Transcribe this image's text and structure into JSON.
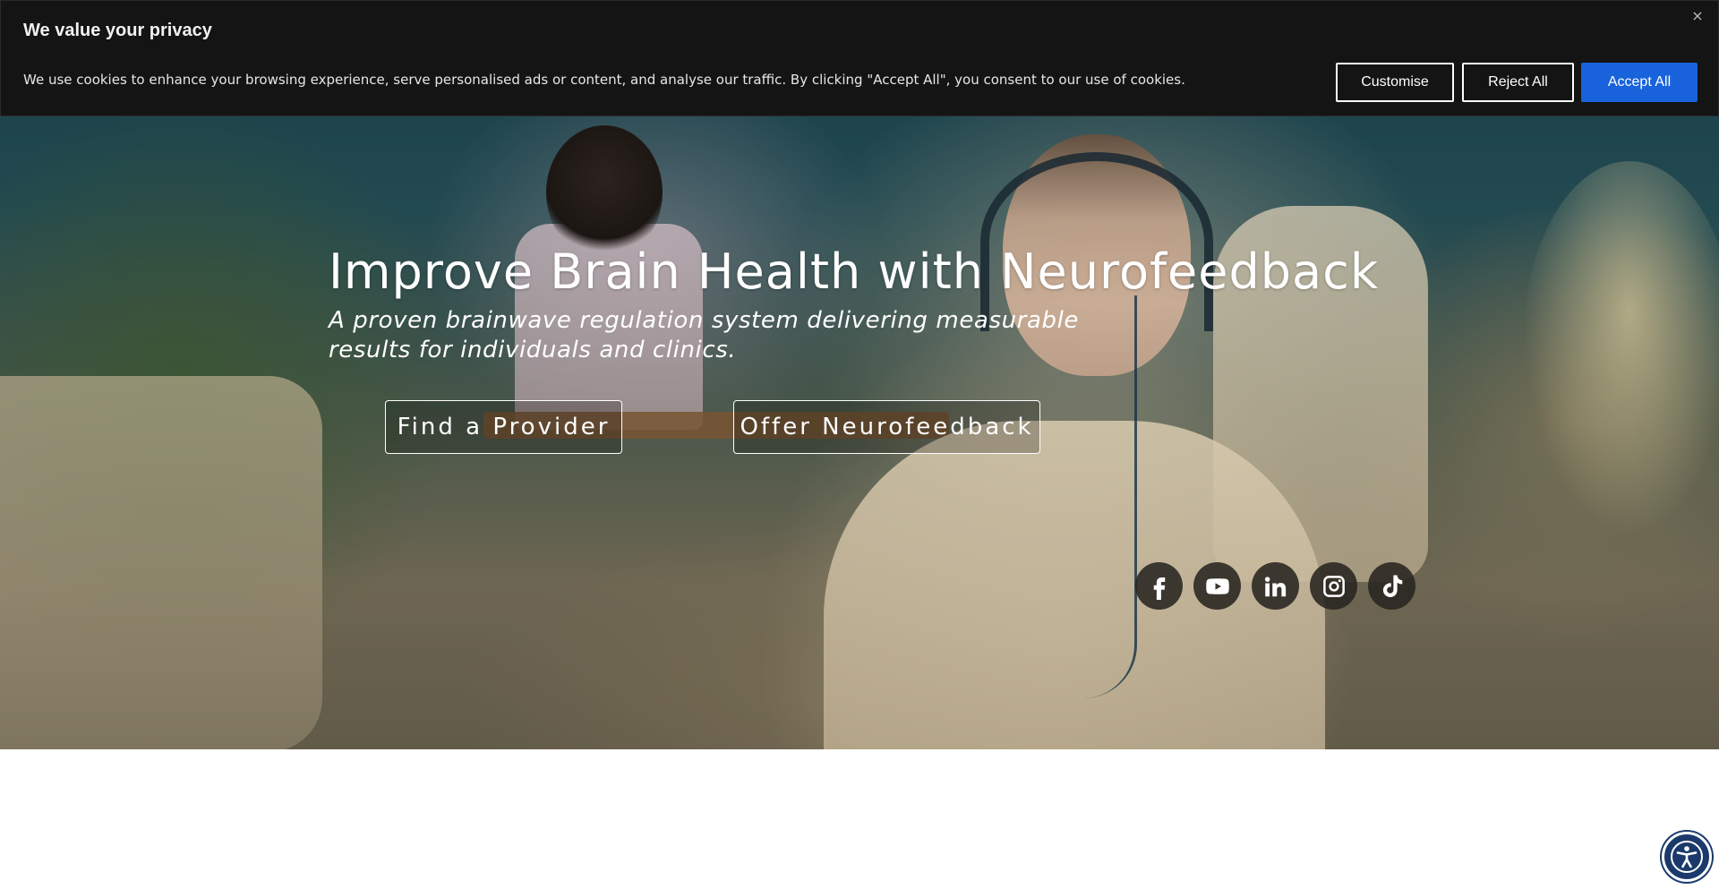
{
  "cookie_banner": {
    "title": "We value your privacy",
    "text": "We use cookies to enhance your browsing experience, serve personalised ads or content, and analyse our traffic. By clicking \"Accept All\", you consent to our use of cookies.",
    "customise_label": "Customise",
    "reject_label": "Reject All",
    "accept_label": "Accept All",
    "close_glyph": "×",
    "accent_color": "#1863dc"
  },
  "hero": {
    "title": "Improve Brain Health with Neurofeedback",
    "subtitle": "A proven brainwave regulation system delivering measurable results for individuals and clinics.",
    "find_provider_label": "Find a Provider",
    "offer_label": "Offer Neurofeedback"
  },
  "socials": [
    {
      "icon": "facebook-icon"
    },
    {
      "icon": "youtube-icon"
    },
    {
      "icon": "linkedin-icon"
    },
    {
      "icon": "instagram-icon"
    },
    {
      "icon": "tiktok-icon"
    }
  ],
  "accessibility_widget": {
    "icon": "accessibility-icon"
  }
}
